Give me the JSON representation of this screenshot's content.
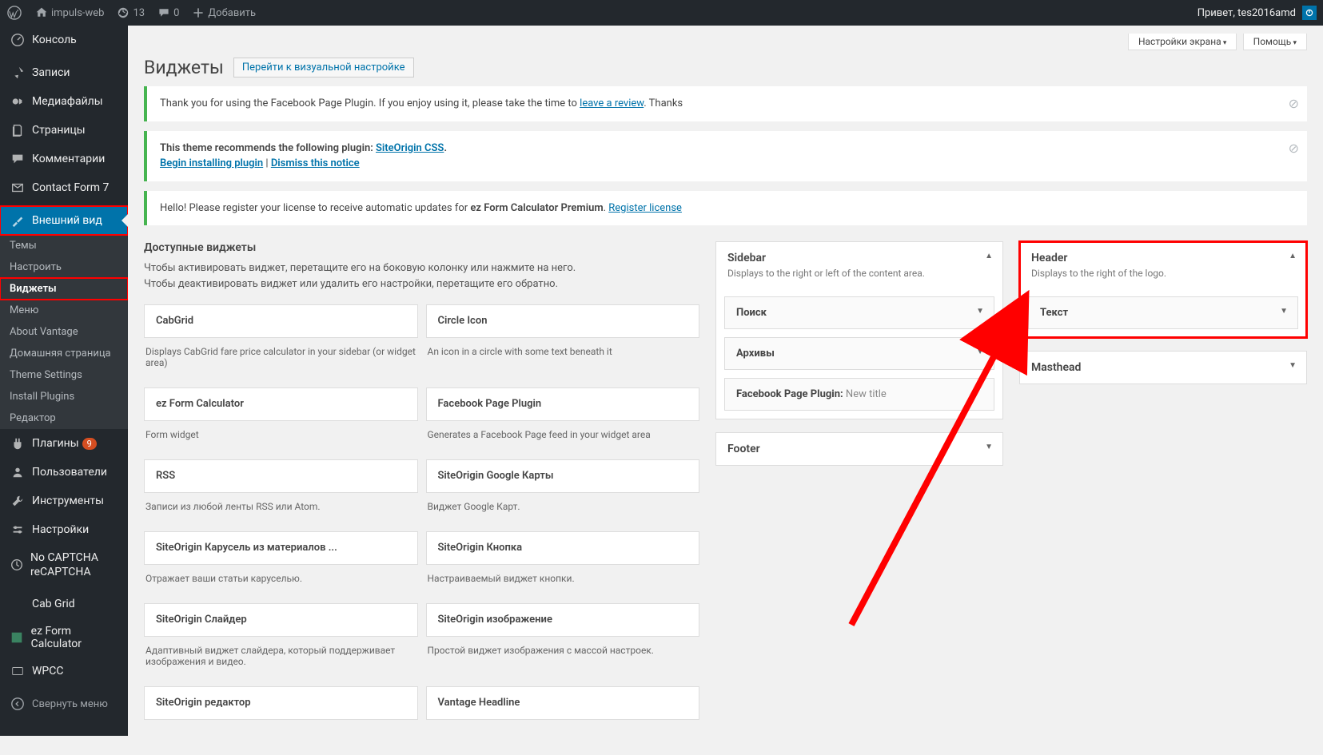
{
  "adminbar": {
    "site_name": "impuls-web",
    "updates_count": "13",
    "comments_count": "0",
    "add_new": "Добавить",
    "greeting": "Привет, tes2016amd"
  },
  "sidebar": {
    "menu": [
      {
        "label": "Консоль",
        "icon": "dashboard"
      },
      {
        "label": "Записи",
        "icon": "pin"
      },
      {
        "label": "Медиафайлы",
        "icon": "media"
      },
      {
        "label": "Страницы",
        "icon": "pages"
      },
      {
        "label": "Комментарии",
        "icon": "comment"
      },
      {
        "label": "Contact Form 7",
        "icon": "mail"
      },
      {
        "label": "Внешний вид",
        "icon": "appearance"
      },
      {
        "label": "Плагины",
        "icon": "plugins",
        "badge": "9"
      },
      {
        "label": "Пользователи",
        "icon": "users"
      },
      {
        "label": "Инструменты",
        "icon": "tools"
      },
      {
        "label": "Настройки",
        "icon": "settings"
      },
      {
        "label": "No CAPTCHA reCAPTCHA",
        "icon": "recaptcha"
      },
      {
        "label": "Cab Grid",
        "icon": ""
      },
      {
        "label": "ez Form Calculator",
        "icon": "ezform"
      },
      {
        "label": "WPCC",
        "icon": "wpcc"
      }
    ],
    "submenu": [
      {
        "label": "Темы"
      },
      {
        "label": "Настроить"
      },
      {
        "label": "Виджеты"
      },
      {
        "label": "Меню"
      },
      {
        "label": "About Vantage"
      },
      {
        "label": "Домашняя страница"
      },
      {
        "label": "Theme Settings"
      },
      {
        "label": "Install Plugins"
      },
      {
        "label": "Редактор"
      }
    ],
    "collapse": "Свернуть меню"
  },
  "screen_tabs": {
    "options": "Настройки экрана",
    "help": "Помощь"
  },
  "heading": {
    "title": "Виджеты",
    "action": "Перейти к визуальной настройке"
  },
  "notices": {
    "n1_pre": "Thank you for using the Facebook Page Plugin. If you enjoy using it, please take the time to ",
    "n1_link": "leave a review",
    "n1_post": ". Thanks",
    "n2_pre": "This theme recommends the following plugin: ",
    "n2_link1": "SiteOrigin CSS",
    "n2_dot": ".",
    "n2_link2": "Begin installing plugin",
    "n2_sep": " | ",
    "n2_link3": "Dismiss this notice",
    "n3_pre": "Hello! Please register your license to receive automatic updates for ",
    "n3_strong": "ez Form Calculator Premium",
    "n3_mid": ". ",
    "n3_link": "Register license"
  },
  "available": {
    "title": "Доступные виджеты",
    "desc1": "Чтобы активировать виджет, перетащите его на боковую колонку или нажмите на него.",
    "desc2": "Чтобы деактивировать виджет или удалить его настройки, перетащите его обратно.",
    "widgets": [
      {
        "title": "CabGrid",
        "desc": "Displays CabGrid fare price calculator in your sidebar (or widget area)"
      },
      {
        "title": "Circle Icon",
        "desc": "An icon in a circle with some text beneath it"
      },
      {
        "title": "ez Form Calculator",
        "desc": "Form widget"
      },
      {
        "title": "Facebook Page Plugin",
        "desc": "Generates a Facebook Page feed in your widget area"
      },
      {
        "title": "RSS",
        "desc": "Записи из любой ленты RSS или Atom."
      },
      {
        "title": "SiteOrigin Google Карты",
        "desc": "Виджет Google Карт."
      },
      {
        "title": "SiteOrigin Карусель из материалов ...",
        "desc": "Отражает ваши статьи каруселью."
      },
      {
        "title": "SiteOrigin Кнопка",
        "desc": "Настраиваемый виджет кнопки."
      },
      {
        "title": "SiteOrigin Слайдер",
        "desc": "Адаптивный виджет слайдера, который поддерживает изображения и видео."
      },
      {
        "title": "SiteOrigin изображение",
        "desc": "Простой виджет изображения с массой настроек."
      },
      {
        "title": "SiteOrigin редактор",
        "desc": ""
      },
      {
        "title": "Vantage Headline",
        "desc": ""
      }
    ]
  },
  "areas": {
    "sidebar": {
      "title": "Sidebar",
      "desc": "Displays to the right or left of the content area.",
      "items": [
        {
          "label": "Поиск",
          "sub": ""
        },
        {
          "label": "Архивы",
          "sub": ""
        },
        {
          "label": "Facebook Page Plugin:",
          "sub": " New title"
        }
      ]
    },
    "footer": {
      "title": "Footer"
    },
    "header": {
      "title": "Header",
      "desc": "Displays to the right of the logo.",
      "items": [
        {
          "label": "Текст",
          "sub": ""
        }
      ]
    },
    "masthead": {
      "title": "Masthead"
    }
  }
}
